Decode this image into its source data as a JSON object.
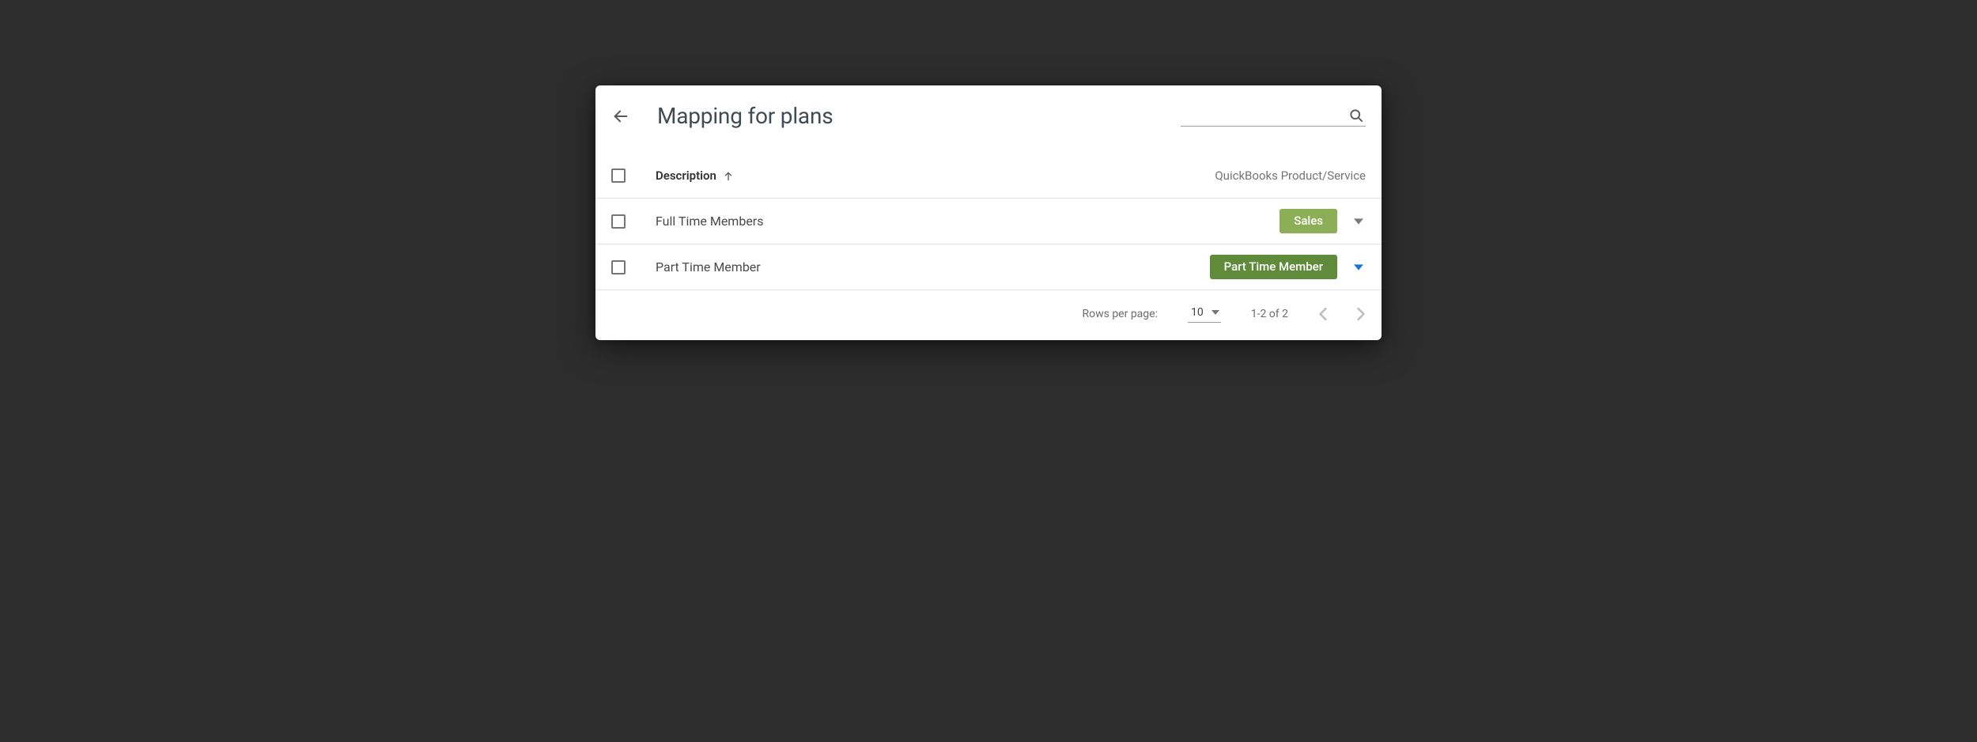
{
  "header": {
    "title": "Mapping for plans",
    "search_placeholder": ""
  },
  "table": {
    "columns": {
      "select": "",
      "description": "Description",
      "product": "QuickBooks Product/Service"
    },
    "sort_direction": "asc",
    "rows": [
      {
        "description": "Full Time Members",
        "product": "Sales",
        "chip_variant": "light",
        "menu_variant": "gray"
      },
      {
        "description": "Part Time Member",
        "product": "Part Time Member",
        "chip_variant": "dark",
        "menu_variant": "blue"
      }
    ]
  },
  "pagination": {
    "rows_per_page_label": "Rows per page:",
    "rows_per_page_value": "10",
    "range_label": "1-2 of 2"
  }
}
